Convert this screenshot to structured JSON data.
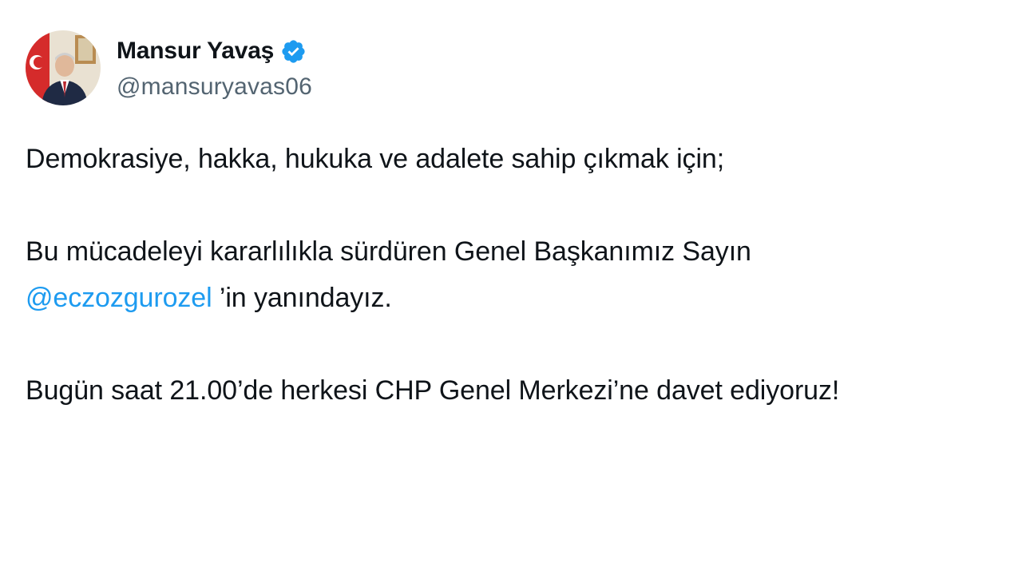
{
  "author": {
    "display_name": "Mansur Yavaş",
    "handle": "@mansuryavas06",
    "verified": true,
    "avatar_icon": "profile-photo"
  },
  "tweet": {
    "paragraph1": "Demokrasiye, hakka, hukuka ve adalete sahip çıkmak için;",
    "paragraph2_line1": "Bu mücadeleyi kararlılıkla sürdüren Genel Başkanımız Sayın",
    "mention": "@eczozgurozel",
    "paragraph2_suffix": " ’in yanındayız.",
    "paragraph3": "Bugün saat 21.00’de herkesi CHP Genel Merkezi’ne davet ediyoruz!"
  },
  "colors": {
    "text": "#0f1419",
    "secondary": "#536471",
    "link": "#1d9bf0",
    "verified_badge": "#1d9bf0"
  }
}
